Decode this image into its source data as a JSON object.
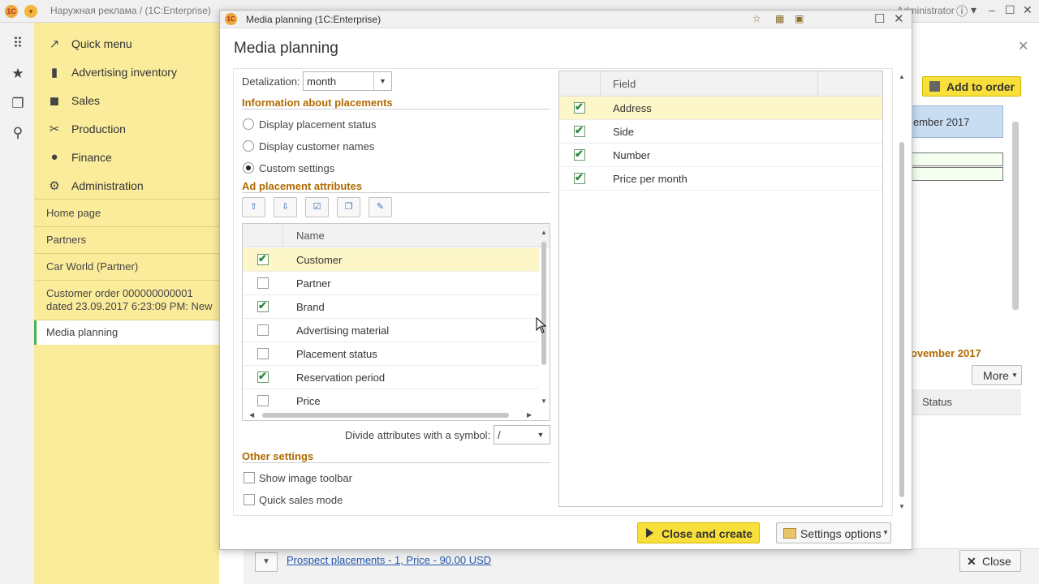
{
  "app": {
    "title": "Наружная реклама /  (1C:Enterprise)",
    "user": "Administrator",
    "logo_text": "1C",
    "icons": [
      "apps-grid-icon",
      "star-icon",
      "history-icon",
      "search-icon"
    ],
    "window_controls": [
      "info-icon",
      "minimize-icon",
      "maximize-icon",
      "close-icon"
    ]
  },
  "nav": {
    "sections": [
      {
        "label": "Quick menu",
        "icon": "trend-icon"
      },
      {
        "label": "Advertising inventory",
        "icon": "bar-chart-icon"
      },
      {
        "label": "Sales",
        "icon": "bag-icon"
      },
      {
        "label": "Production",
        "icon": "tools-icon"
      },
      {
        "label": "Finance",
        "icon": "coin-icon"
      },
      {
        "label": "Administration",
        "icon": "gear-icon"
      }
    ],
    "open_windows": [
      {
        "label": "Home page"
      },
      {
        "label": "Partners"
      },
      {
        "label": "Car World (Partner)"
      },
      {
        "label": "Customer order 000000000001 dated 23.09.2017 6:23:09 PM: New"
      },
      {
        "label": "Media planning",
        "active": true
      }
    ]
  },
  "background_form": {
    "add_to_order": "Add to order",
    "calendar_month": "ember 2017",
    "november_label": "ovember 2017",
    "more_button": "More",
    "status_header": "Status",
    "prospect_link": "Prospect placements - 1, Price - 90.00 USD",
    "close_button": "Close"
  },
  "dialog": {
    "window_title": "Media planning  (1C:Enterprise)",
    "heading": "Media planning",
    "detalization": {
      "label": "Detalization:",
      "value": "month"
    },
    "info_section": "Information about placements",
    "radios": [
      {
        "label": "Display placement status",
        "selected": false
      },
      {
        "label": "Display customer names",
        "selected": false
      },
      {
        "label": "Custom settings",
        "selected": true
      }
    ],
    "attr_section": "Ad placement attributes",
    "toolbar_buttons": [
      "move-up-icon",
      "move-down-icon",
      "check-all-icon",
      "uncheck-all-icon",
      "edit-icon"
    ],
    "attr_table": {
      "header": "Name",
      "rows": [
        {
          "name": "Customer",
          "checked": true,
          "selected": true
        },
        {
          "name": "Partner",
          "checked": false
        },
        {
          "name": "Brand",
          "checked": true
        },
        {
          "name": "Advertising material",
          "checked": false
        },
        {
          "name": "Placement status",
          "checked": false
        },
        {
          "name": "Reservation period",
          "checked": true
        },
        {
          "name": "Price",
          "checked": false
        }
      ]
    },
    "divide": {
      "label": "Divide attributes with a symbol:",
      "value": "/"
    },
    "other_section": "Other settings",
    "other_checkboxes": [
      {
        "label": "Show image toolbar",
        "checked": false
      },
      {
        "label": "Quick sales mode",
        "checked": false
      }
    ],
    "field_table": {
      "header": "Field",
      "rows": [
        {
          "name": "Address",
          "checked": true,
          "selected": true
        },
        {
          "name": "Side",
          "checked": true
        },
        {
          "name": "Number",
          "checked": true
        },
        {
          "name": "Price per month",
          "checked": true
        }
      ]
    },
    "close_and_create": "Close and create",
    "settings_options": "Settings options"
  }
}
